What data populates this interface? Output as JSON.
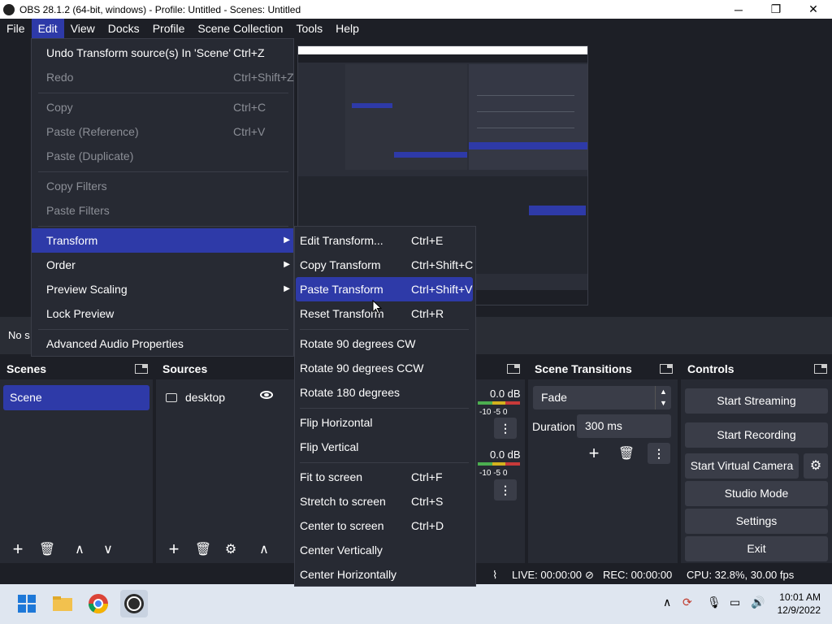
{
  "window": {
    "title": "OBS 28.1.2 (64-bit, windows) - Profile: Untitled - Scenes: Untitled",
    "minimize": "─",
    "maximize": "❐",
    "close": "✕"
  },
  "menubar": [
    "File",
    "Edit",
    "View",
    "Docks",
    "Profile",
    "Scene Collection",
    "Tools",
    "Help"
  ],
  "edit_menu": {
    "items": [
      {
        "label": "Undo Transform source(s) In 'Scene'",
        "shortcut": "Ctrl+Z",
        "disabled": false
      },
      {
        "label": "Redo",
        "shortcut": "Ctrl+Shift+Z",
        "disabled": true
      },
      {
        "label": "Copy",
        "shortcut": "Ctrl+C",
        "disabled": true
      },
      {
        "label": "Paste (Reference)",
        "shortcut": "Ctrl+V",
        "disabled": true
      },
      {
        "label": "Paste (Duplicate)",
        "shortcut": "",
        "disabled": true
      },
      {
        "label": "Copy Filters",
        "shortcut": "",
        "disabled": true
      },
      {
        "label": "Paste Filters",
        "shortcut": "",
        "disabled": true
      },
      {
        "label": "Transform",
        "shortcut": "",
        "disabled": false,
        "submenu": true,
        "highlighted": true
      },
      {
        "label": "Order",
        "shortcut": "",
        "disabled": false,
        "submenu": true
      },
      {
        "label": "Preview Scaling",
        "shortcut": "",
        "disabled": false,
        "submenu": true
      },
      {
        "label": "Lock Preview",
        "shortcut": "",
        "disabled": false
      },
      {
        "label": "Advanced Audio Properties",
        "shortcut": "",
        "disabled": false
      }
    ]
  },
  "transform_menu": {
    "items": [
      {
        "label": "Edit Transform...",
        "shortcut": "Ctrl+E"
      },
      {
        "label": "Copy Transform",
        "shortcut": "Ctrl+Shift+C"
      },
      {
        "label": "Paste Transform",
        "shortcut": "Ctrl+Shift+V",
        "highlighted": true
      },
      {
        "label": "Reset Transform",
        "shortcut": "Ctrl+R"
      },
      {
        "label": "Rotate 90 degrees CW",
        "shortcut": ""
      },
      {
        "label": "Rotate 90 degrees CCW",
        "shortcut": ""
      },
      {
        "label": "Rotate 180 degrees",
        "shortcut": ""
      },
      {
        "label": "Flip Horizontal",
        "shortcut": ""
      },
      {
        "label": "Flip Vertical",
        "shortcut": ""
      },
      {
        "label": "Fit to screen",
        "shortcut": "Ctrl+F"
      },
      {
        "label": "Stretch to screen",
        "shortcut": "Ctrl+S"
      },
      {
        "label": "Center to screen",
        "shortcut": "Ctrl+D"
      },
      {
        "label": "Center Vertically",
        "shortcut": ""
      },
      {
        "label": "Center Horizontally",
        "shortcut": ""
      }
    ]
  },
  "status_strip": {
    "text": "No s"
  },
  "scenes": {
    "title": "Scenes",
    "items": [
      "Scene"
    ]
  },
  "sources": {
    "title": "Sources",
    "items": [
      "desktop"
    ]
  },
  "mixer": {
    "db1": "0.0 dB",
    "db2": "0.0 dB",
    "ticks1": "-10  -5    0",
    "ticks2": "-10  -5    0"
  },
  "transitions": {
    "title": "Scene Transitions",
    "selected": "Fade",
    "duration_label": "Duration",
    "duration_value": "300 ms"
  },
  "controls": {
    "title": "Controls",
    "start_streaming": "Start Streaming",
    "start_recording": "Start Recording",
    "start_virtual_camera": "Start Virtual Camera",
    "studio_mode": "Studio Mode",
    "settings": "Settings",
    "exit": "Exit"
  },
  "bottom_status": {
    "live": "LIVE: 00:00:00",
    "rec": "REC: 00:00:00",
    "cpu": "CPU: 32.8%, 30.00 fps"
  },
  "taskbar": {
    "time": "10:01 AM",
    "date": "12/9/2022"
  },
  "colors": {
    "accent": "#2e3aa8",
    "background": "#1d1f26",
    "panel": "#272a33",
    "button": "#3a3d48"
  }
}
